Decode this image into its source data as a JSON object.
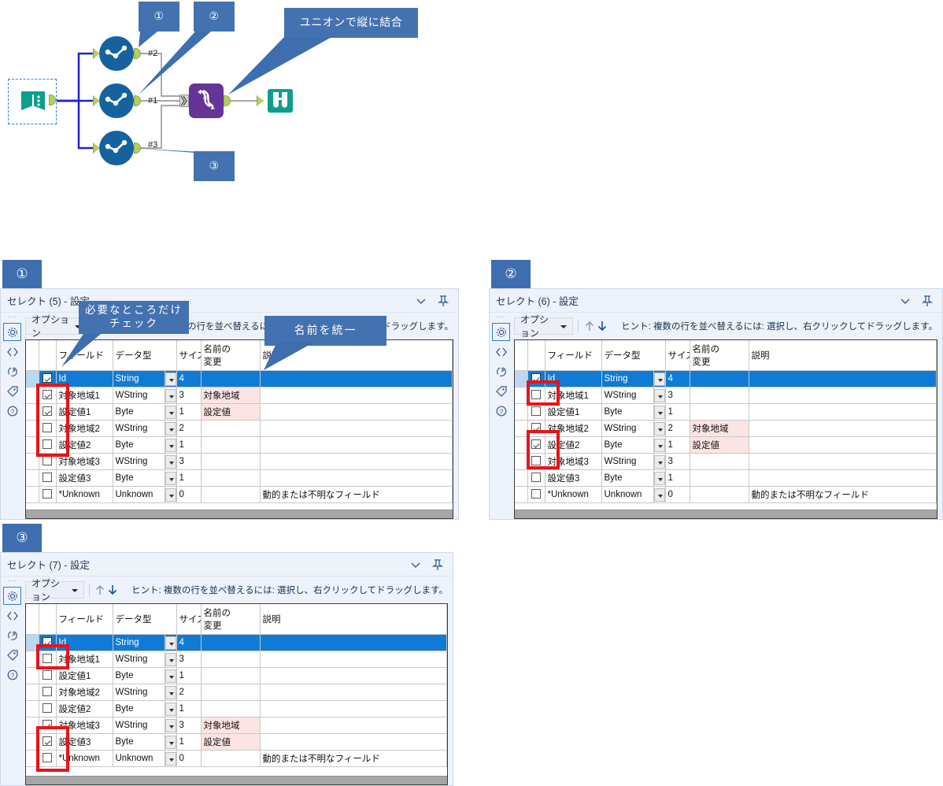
{
  "workflow": {
    "callouts": [
      {
        "id": "c1",
        "text": "①"
      },
      {
        "id": "c2",
        "text": "②"
      },
      {
        "id": "c3",
        "text": "ユニオンで縦に結合"
      },
      {
        "id": "c4",
        "text": "③"
      }
    ],
    "connection_labels": [
      "#2",
      "#1",
      "#3"
    ],
    "nodes": [
      {
        "name": "input-data-tool",
        "icon": "book-icon",
        "color": "#0f9e8e"
      },
      {
        "name": "select-tool-1",
        "icon": "select-check-icon",
        "color": "#15629f"
      },
      {
        "name": "select-tool-2",
        "icon": "select-check-icon",
        "color": "#15629f"
      },
      {
        "name": "select-tool-3",
        "icon": "select-check-icon",
        "color": "#15629f"
      },
      {
        "name": "union-tool",
        "icon": "union-helix-icon",
        "color": "#663399"
      },
      {
        "name": "browse-tool",
        "icon": "binoculars-icon",
        "color": "#0f9e8e"
      }
    ]
  },
  "common": {
    "options_label": "オプション",
    "hint": "ヒント: 複数の行を並べ替えるには: 選択し、右クリックしてドラッグします。",
    "columns": [
      "フィールド",
      "データ型",
      "サイズ",
      "名前の\n変更",
      "説明"
    ],
    "col_field": "フィールド",
    "col_type": "データ型",
    "col_size": "サイズ",
    "col_rename": "名前の\n変更",
    "col_desc": "説明",
    "unknown_desc": "動的または不明なフィールド",
    "rail_icons": [
      "gear-icon",
      "code-icon",
      "refresh-icon",
      "tag-icon",
      "help-icon"
    ],
    "accent": "#0f7bd4",
    "rename_bg": "#fce4e4",
    "highlight_red": "#e8131a"
  },
  "panels": [
    {
      "badge": "①",
      "title": "セレクト (5) - 設定",
      "callouts": [
        {
          "text": "必要なところだけ\nチェック"
        },
        {
          "text": "名前を統一"
        }
      ],
      "rows": [
        {
          "checked": true,
          "field": "Id",
          "type": "String",
          "size": "4",
          "rename": "",
          "desc": "",
          "selected": true
        },
        {
          "checked": true,
          "field": "対象地域1",
          "type": "WString",
          "size": "3",
          "rename": "対象地域",
          "desc": ""
        },
        {
          "checked": true,
          "field": "設定値1",
          "type": "Byte",
          "size": "1",
          "rename": "設定値",
          "desc": ""
        },
        {
          "checked": false,
          "field": "対象地域2",
          "type": "WString",
          "size": "2",
          "rename": "",
          "desc": ""
        },
        {
          "checked": false,
          "field": "設定値2",
          "type": "Byte",
          "size": "1",
          "rename": "",
          "desc": ""
        },
        {
          "checked": false,
          "field": "対象地域3",
          "type": "WString",
          "size": "3",
          "rename": "",
          "desc": ""
        },
        {
          "checked": false,
          "field": "設定値3",
          "type": "Byte",
          "size": "1",
          "rename": "",
          "desc": ""
        },
        {
          "checked": false,
          "field": "*Unknown",
          "type": "Unknown",
          "size": "0",
          "rename": "",
          "desc": "動的または不明なフィールド",
          "dim": true
        }
      ]
    },
    {
      "badge": "②",
      "title": "セレクト (6) - 設定",
      "callouts": [],
      "rows": [
        {
          "checked": true,
          "field": "Id",
          "type": "String",
          "size": "4",
          "rename": "",
          "desc": "",
          "selected": true
        },
        {
          "checked": false,
          "field": "対象地域1",
          "type": "WString",
          "size": "3",
          "rename": "",
          "desc": ""
        },
        {
          "checked": false,
          "field": "設定値1",
          "type": "Byte",
          "size": "1",
          "rename": "",
          "desc": ""
        },
        {
          "checked": true,
          "field": "対象地域2",
          "type": "WString",
          "size": "2",
          "rename": "対象地域",
          "desc": ""
        },
        {
          "checked": true,
          "field": "設定値2",
          "type": "Byte",
          "size": "1",
          "rename": "設定値",
          "desc": ""
        },
        {
          "checked": false,
          "field": "対象地域3",
          "type": "WString",
          "size": "3",
          "rename": "",
          "desc": ""
        },
        {
          "checked": false,
          "field": "設定値3",
          "type": "Byte",
          "size": "1",
          "rename": "",
          "desc": ""
        },
        {
          "checked": false,
          "field": "*Unknown",
          "type": "Unknown",
          "size": "0",
          "rename": "",
          "desc": "動的または不明なフィールド",
          "dim": true
        }
      ]
    },
    {
      "badge": "③",
      "title": "セレクト (7) - 設定",
      "callouts": [],
      "rows": [
        {
          "checked": true,
          "field": "Id",
          "type": "String",
          "size": "4",
          "rename": "",
          "desc": "",
          "selected": true
        },
        {
          "checked": false,
          "field": "対象地域1",
          "type": "WString",
          "size": "3",
          "rename": "",
          "desc": ""
        },
        {
          "checked": false,
          "field": "設定値1",
          "type": "Byte",
          "size": "1",
          "rename": "",
          "desc": ""
        },
        {
          "checked": false,
          "field": "対象地域2",
          "type": "WString",
          "size": "2",
          "rename": "",
          "desc": ""
        },
        {
          "checked": false,
          "field": "設定値2",
          "type": "Byte",
          "size": "1",
          "rename": "",
          "desc": ""
        },
        {
          "checked": true,
          "field": "対象地域3",
          "type": "WString",
          "size": "3",
          "rename": "対象地域",
          "desc": ""
        },
        {
          "checked": true,
          "field": "設定値3",
          "type": "Byte",
          "size": "1",
          "rename": "設定値",
          "desc": ""
        },
        {
          "checked": false,
          "field": "*Unknown",
          "type": "Unknown",
          "size": "0",
          "rename": "",
          "desc": "動的または不明なフィールド",
          "dim": true
        }
      ]
    }
  ]
}
